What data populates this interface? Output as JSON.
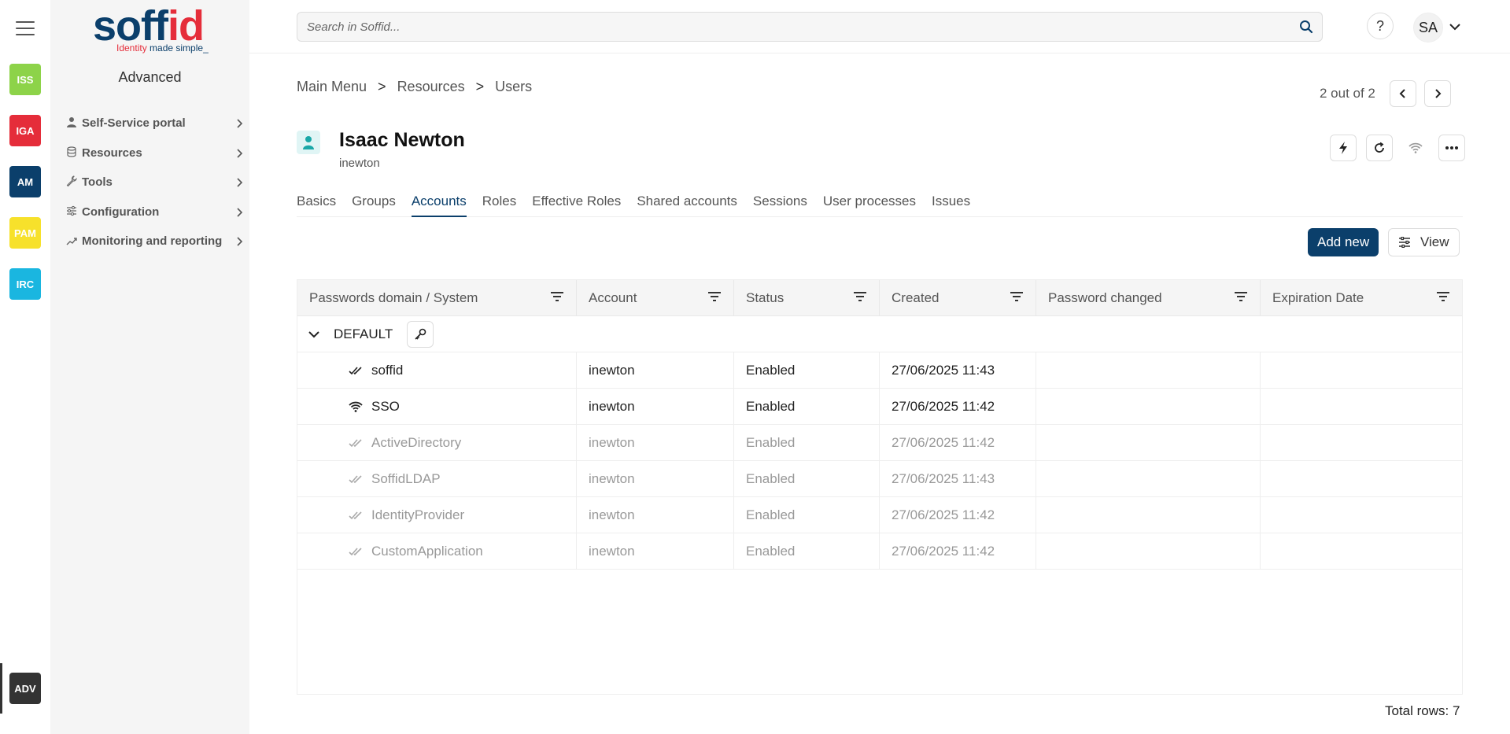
{
  "rail": {
    "modules": [
      {
        "label": "ISS",
        "color": "#8dd349"
      },
      {
        "label": "IGA",
        "color": "#e52d3a"
      },
      {
        "label": "AM",
        "color": "#0b3f6b"
      },
      {
        "label": "PAM",
        "color": "#f7e12b"
      },
      {
        "label": "IRC",
        "color": "#1ab6e0"
      }
    ],
    "active_module": "ADV"
  },
  "logo": {
    "word_main": "soff",
    "word_accent": "id",
    "tagline_accent": "Identity",
    "tagline_rest": " made simple_"
  },
  "sidebar": {
    "title": "Advanced",
    "items": [
      {
        "label": "Self-Service portal"
      },
      {
        "label": "Resources"
      },
      {
        "label": "Tools"
      },
      {
        "label": "Configuration"
      },
      {
        "label": "Monitoring and reporting"
      }
    ]
  },
  "topbar": {
    "search_placeholder": "Search in Soffid...",
    "help_label": "?",
    "avatar_initials": "SA"
  },
  "breadcrumb": [
    "Main Menu",
    "Resources",
    "Users"
  ],
  "breadcrumb_sep": ">",
  "pager": {
    "text": "2 out of 2"
  },
  "user": {
    "name": "Isaac Newton",
    "login": "inewton"
  },
  "tabs": [
    {
      "label": "Basics"
    },
    {
      "label": "Groups"
    },
    {
      "label": "Accounts",
      "active": true
    },
    {
      "label": "Roles"
    },
    {
      "label": "Effective Roles"
    },
    {
      "label": "Shared accounts"
    },
    {
      "label": "Sessions"
    },
    {
      "label": "User processes"
    },
    {
      "label": "Issues"
    }
  ],
  "toolbar": {
    "add_label": "Add new",
    "view_label": "View"
  },
  "table": {
    "columns": [
      "Passwords domain / System",
      "Account",
      "Status",
      "Created",
      "Password changed",
      "Expiration Date"
    ],
    "group": "DEFAULT",
    "rows": [
      {
        "system": "soffid",
        "icon": "double-check-icon",
        "account": "inewton",
        "status": "Enabled",
        "created": "27/06/2025 11:43",
        "pwd_changed": "",
        "expiration": "",
        "dim": false
      },
      {
        "system": "SSO",
        "icon": "wifi-icon",
        "account": "inewton",
        "status": "Enabled",
        "created": "27/06/2025 11:42",
        "pwd_changed": "",
        "expiration": "",
        "dim": false
      },
      {
        "system": "ActiveDirectory",
        "icon": "double-check-icon",
        "account": "inewton",
        "status": "Enabled",
        "created": "27/06/2025 11:42",
        "pwd_changed": "",
        "expiration": "",
        "dim": true
      },
      {
        "system": "SoffidLDAP",
        "icon": "double-check-icon",
        "account": "inewton",
        "status": "Enabled",
        "created": "27/06/2025 11:43",
        "pwd_changed": "",
        "expiration": "",
        "dim": true
      },
      {
        "system": "IdentityProvider",
        "icon": "double-check-icon",
        "account": "inewton",
        "status": "Enabled",
        "created": "27/06/2025 11:42",
        "pwd_changed": "",
        "expiration": "",
        "dim": true
      },
      {
        "system": "CustomApplication",
        "icon": "double-check-icon",
        "account": "inewton",
        "status": "Enabled",
        "created": "27/06/2025 11:42",
        "pwd_changed": "",
        "expiration": "",
        "dim": true
      }
    ],
    "total_label": "Total rows: 7"
  }
}
